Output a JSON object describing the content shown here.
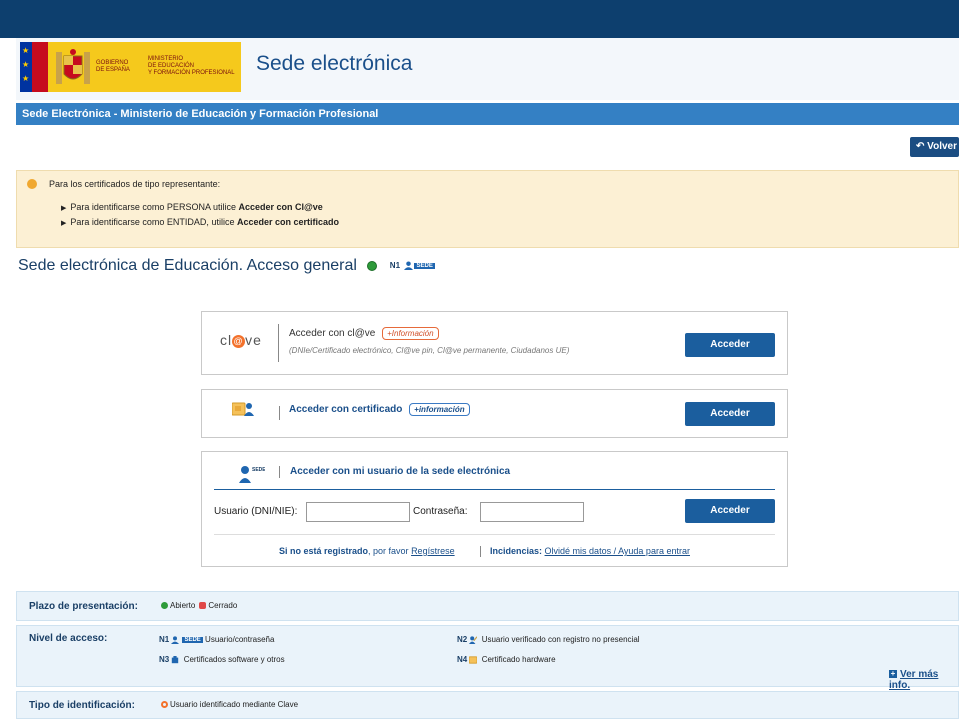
{
  "header": {
    "gobierno": "GOBIERNO\nDE ESPAÑA",
    "ministerio": "MINISTERIO\nDE EDUCACIÓN\nY FORMACIÓN PROFESIONAL",
    "site_title": "Sede electrónica"
  },
  "navbar": {
    "title": "Sede Electrónica - Ministerio de Educación y Formación Profesional"
  },
  "volver_label": "Volver",
  "notice": {
    "intro": "Para los certificados de tipo representante:",
    "line1_pre": "Para identificarse como PERSONA utilice ",
    "line1_bold": "Acceder con Cl@ve",
    "line2_pre": "Para identificarse como ENTIDAD, utilice ",
    "line2_bold": "Acceder con certificado"
  },
  "page_heading": "Sede electrónica de Educación. Acceso general",
  "level_n1": "N1",
  "sede_badge": "SEDE",
  "cards": {
    "clave": {
      "logo": "cl@ve",
      "title": "Acceder con cl@ve",
      "info": "+Información",
      "subtitle": "(DNIe/Certificado electrónico, Cl@ve pin, Cl@ve permanente, Ciudadanos UE)",
      "button": "Acceder"
    },
    "certificado": {
      "title": "Acceder con certificado",
      "info": "+información",
      "button": "Acceder"
    },
    "usuario": {
      "title": "Acceder con mi usuario de la sede electrónica",
      "user_label": "Usuario (DNI/NIE):",
      "pass_label": "Contraseña:",
      "button": "Acceder",
      "not_registered_bold": "Si no está registrado",
      "not_registered_rest": ", por favor ",
      "register_link": "Regístrese",
      "incidencias_label": "Incidencias:",
      "incidencias_link": "Olvidé mis datos / Ayuda para entrar"
    }
  },
  "plazo": {
    "label": "Plazo de presentación:",
    "abierto": "Abierto",
    "cerrado": "Cerrado"
  },
  "nivel": {
    "label": "Nivel de acceso:",
    "n1": "N1",
    "n1_text": "Usuario/contraseña",
    "n2": "N2",
    "n2_text": "Usuario verificado con registro no presencial",
    "n3": "N3",
    "n3_text": "Certificados software y otros",
    "n4": "N4",
    "n4_text": "Certificado hardware",
    "ver_mas": "Ver más info."
  },
  "tipo": {
    "label": "Tipo de identificación:",
    "value": "Usuario identificado mediante Clave"
  }
}
